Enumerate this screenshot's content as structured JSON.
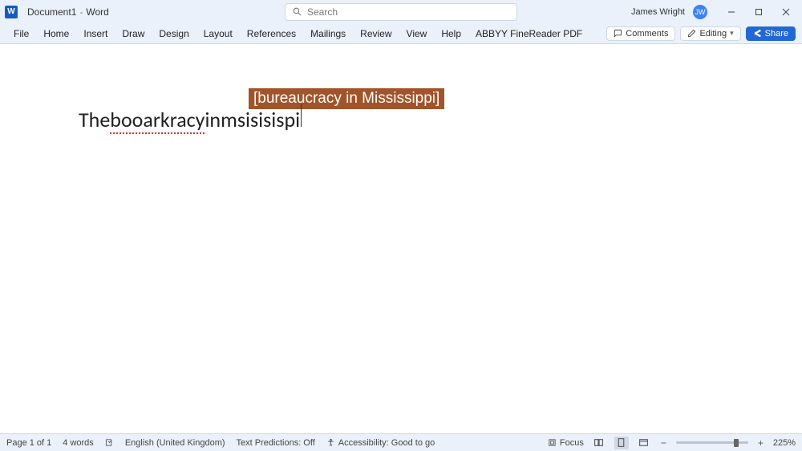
{
  "titlebar": {
    "doc_name": "Document1",
    "app_name": "Word",
    "search_placeholder": "Search",
    "user_name": "James Wright",
    "user_initials": "JW"
  },
  "menus": {
    "items": [
      "File",
      "Home",
      "Insert",
      "Draw",
      "Design",
      "Layout",
      "References",
      "Mailings",
      "Review",
      "View",
      "Help",
      "ABBYY FineReader PDF"
    ]
  },
  "right_controls": {
    "comments_label": "Comments",
    "editing_label": "Editing",
    "share_label": "Share"
  },
  "document": {
    "text_leading": "The ",
    "misspelled1": "booarkracy",
    "text_mid": " in ",
    "misspelled2": "msisisispi",
    "suggestion": "[bureaucracy in Mississippi]"
  },
  "statusbar": {
    "page": "Page 1 of 1",
    "words": "4 words",
    "language": "English (United Kingdom)",
    "predictions": "Text Predictions: Off",
    "accessibility": "Accessibility: Good to go",
    "focus": "Focus",
    "zoom": "225%"
  }
}
